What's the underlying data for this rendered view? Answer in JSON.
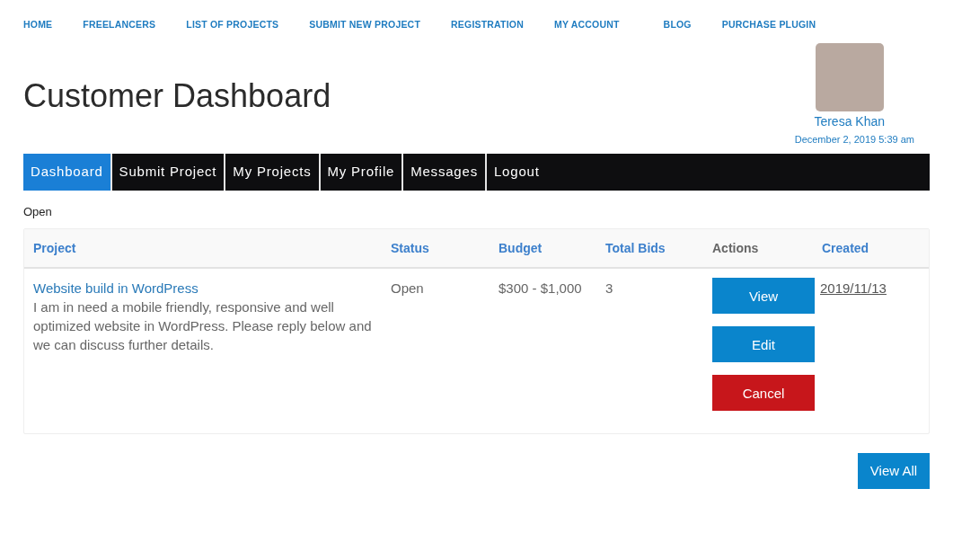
{
  "top_nav": {
    "items": [
      "HOME",
      "FREELANCERS",
      "LIST OF PROJECTS",
      "SUBMIT NEW PROJECT",
      "REGISTRATION",
      "MY ACCOUNT",
      "BLOG",
      "PURCHASE PLUGIN"
    ]
  },
  "page_title": "Customer Dashboard",
  "user": {
    "name": "Teresa Khan",
    "datetime": "December 2, 2019 5:39 am"
  },
  "tabs": [
    {
      "label": "Dashboard",
      "selected": true
    },
    {
      "label": "Submit Project",
      "selected": false
    },
    {
      "label": "My Projects",
      "selected": false
    },
    {
      "label": "My Profile",
      "selected": false
    },
    {
      "label": "Messages",
      "selected": false
    },
    {
      "label": "Logout",
      "selected": false
    }
  ],
  "filter_label": "Open",
  "table": {
    "columns": [
      {
        "label": "Project",
        "sortable": true
      },
      {
        "label": "Status",
        "sortable": true
      },
      {
        "label": "Budget",
        "sortable": true
      },
      {
        "label": "Total Bids",
        "sortable": true
      },
      {
        "label": "Actions",
        "sortable": false
      },
      {
        "label": "Created",
        "sortable": true
      }
    ],
    "rows": [
      {
        "project_title": "Website build in WordPress",
        "description": "I am in need a mobile friendly, responsive and well optimized website in WordPress. Please reply below and we can discuss further details.",
        "status": "Open",
        "budget": "$300 - $1,000",
        "total_bids": "3",
        "actions": [
          {
            "label": "View",
            "kind": "primary"
          },
          {
            "label": "Edit",
            "kind": "primary"
          },
          {
            "label": "Cancel",
            "kind": "danger"
          }
        ],
        "created": "2019/11/13"
      }
    ]
  },
  "view_all_button": "View All"
}
